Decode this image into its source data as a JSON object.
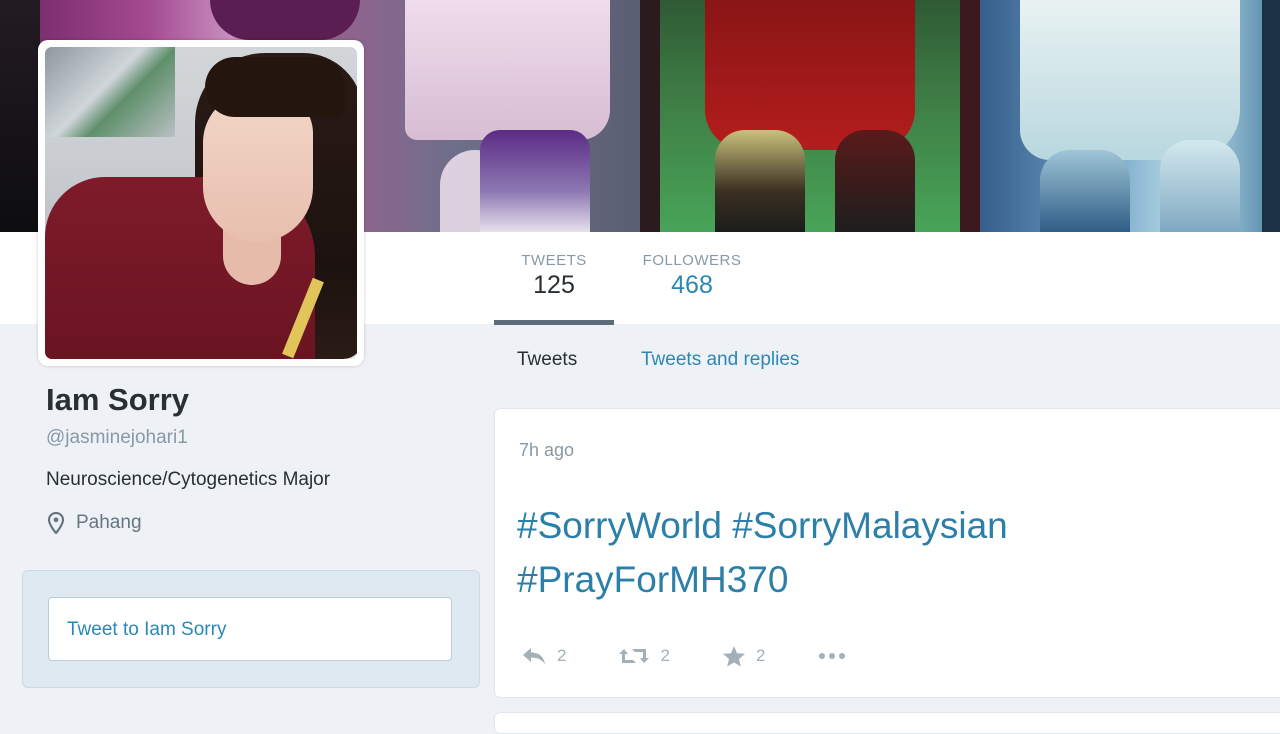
{
  "profile": {
    "name": "Iam Sorry",
    "handle": "@jasminejohari1",
    "bio": "Neuroscience/Cytogenetics Major",
    "location": "Pahang"
  },
  "stats": {
    "tweets_label": "TWEETS",
    "tweets_value": "125",
    "followers_label": "FOLLOWERS",
    "followers_value": "468"
  },
  "tabs": {
    "tweets": "Tweets",
    "replies": "Tweets and replies"
  },
  "compose": {
    "placeholder": "Tweet to Iam Sorry"
  },
  "tweet": {
    "time": "7h ago",
    "line1": "#SorryWorld #SorryMalaysian",
    "line2": "#PrayForMH370",
    "reply_count": "2",
    "retweet_count": "2",
    "favorite_count": "2"
  },
  "colors": {
    "link": "#2b88b3",
    "muted": "#8899a6",
    "text": "#292f33",
    "background": "#eef2f6"
  },
  "icons": [
    "location-pin-icon",
    "reply-icon",
    "retweet-icon",
    "star-icon",
    "more-icon"
  ]
}
